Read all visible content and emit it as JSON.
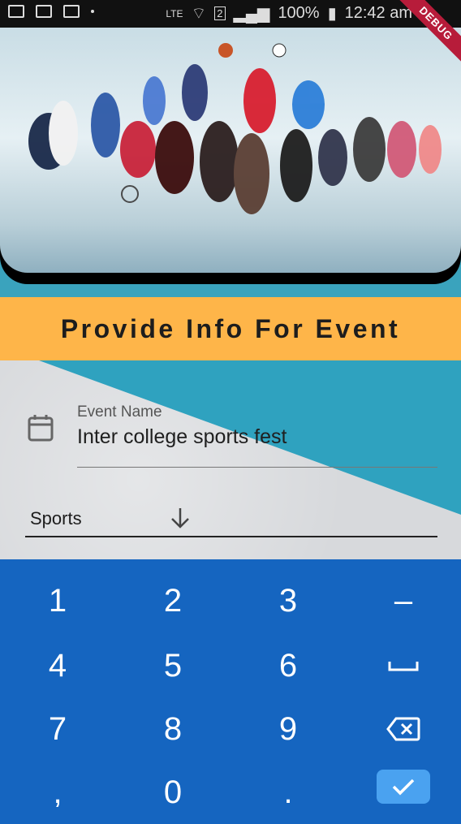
{
  "status_bar": {
    "network": "LTE",
    "sim_slot": "2",
    "battery": "100%",
    "time": "12:42 am"
  },
  "debug_ribbon": "DEBUG",
  "hero": {
    "image": "sports-athletes-collage"
  },
  "banner": {
    "title": "Provide Info For Event"
  },
  "form": {
    "event_name": {
      "label": "Event Name",
      "value": "Inter college sports fest",
      "icon": "calendar-icon"
    },
    "category": {
      "value": "Sports",
      "icon": "arrow-down-icon"
    }
  },
  "keypad": {
    "rows": [
      [
        "1",
        "2",
        "3",
        "–"
      ],
      [
        "4",
        "5",
        "6",
        "␣"
      ],
      [
        "7",
        "8",
        "9",
        "⌫"
      ],
      [
        ",",
        "0",
        ".",
        "✓"
      ]
    ]
  },
  "colors": {
    "banner": "#feb549",
    "keypad": "#1565c0",
    "done_key": "#4aa2f0"
  }
}
